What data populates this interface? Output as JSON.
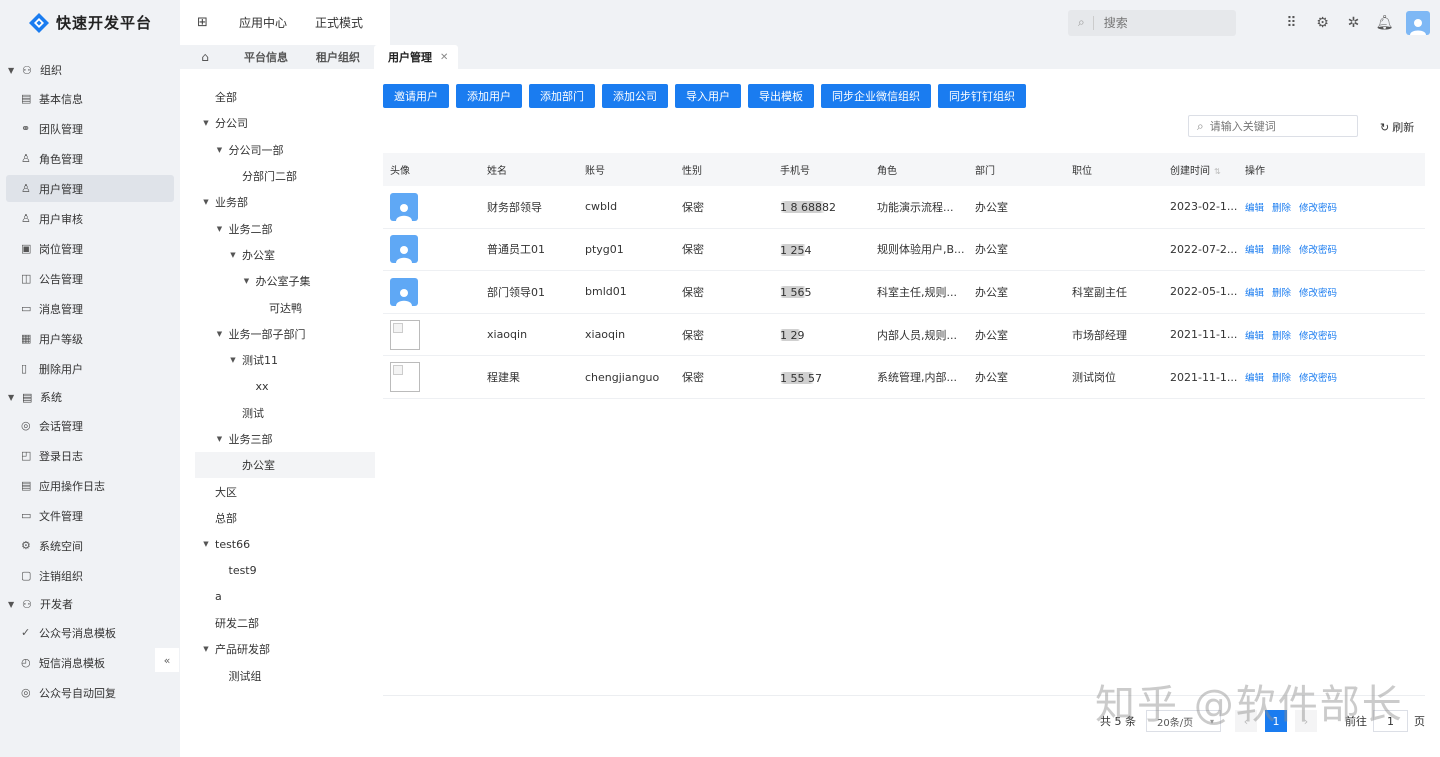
{
  "app": {
    "title": "快速开发平台"
  },
  "topnav": {
    "items": [
      "应用中心",
      "正式模式"
    ]
  },
  "header": {
    "search_placeholder": "搜索"
  },
  "colors": {
    "primary": "#1a7cf0",
    "sidebar_bg": "#f0f2f5",
    "avatar": "#5fa8f5"
  },
  "sidebar": {
    "groups": [
      {
        "label": "组织",
        "icon": "org-icon",
        "items": [
          {
            "label": "基本信息",
            "icon": "info-icon"
          },
          {
            "label": "团队管理",
            "icon": "team-icon"
          },
          {
            "label": "角色管理",
            "icon": "role-icon"
          },
          {
            "label": "用户管理",
            "icon": "user-icon",
            "active": true
          },
          {
            "label": "用户审核",
            "icon": "audit-icon"
          },
          {
            "label": "岗位管理",
            "icon": "post-icon"
          },
          {
            "label": "公告管理",
            "icon": "notice-icon"
          },
          {
            "label": "消息管理",
            "icon": "message-icon"
          },
          {
            "label": "用户等级",
            "icon": "level-icon"
          },
          {
            "label": "删除用户",
            "icon": "trash-icon"
          }
        ]
      },
      {
        "label": "系统",
        "icon": "system-icon",
        "items": [
          {
            "label": "会话管理",
            "icon": "session-icon"
          },
          {
            "label": "登录日志",
            "icon": "login-log-icon"
          },
          {
            "label": "应用操作日志",
            "icon": "op-log-icon"
          },
          {
            "label": "文件管理",
            "icon": "folder-icon"
          },
          {
            "label": "系统空间",
            "icon": "space-icon"
          },
          {
            "label": "注销组织",
            "icon": "cancel-org-icon"
          }
        ]
      },
      {
        "label": "开发者",
        "icon": "developer-icon",
        "items": [
          {
            "label": "公众号消息模板",
            "icon": "template-icon"
          },
          {
            "label": "短信消息模板",
            "icon": "sms-icon"
          },
          {
            "label": "公众号自动回复",
            "icon": "reply-icon"
          }
        ]
      }
    ]
  },
  "tabs": {
    "items": [
      "平台信息",
      "租户组织",
      "用户管理"
    ],
    "active": "用户管理"
  },
  "tree": [
    {
      "label": "全部",
      "level": 0,
      "caret": false
    },
    {
      "label": "分公司",
      "level": 0,
      "caret": true
    },
    {
      "label": "分公司一部",
      "level": 1,
      "caret": true
    },
    {
      "label": "分部门二部",
      "level": 2,
      "caret": false
    },
    {
      "label": "业务部",
      "level": 0,
      "caret": true
    },
    {
      "label": "业务二部",
      "level": 1,
      "caret": true
    },
    {
      "label": "办公室",
      "level": 2,
      "caret": true
    },
    {
      "label": "办公室子集",
      "level": 3,
      "caret": true
    },
    {
      "label": "可达鸭",
      "level": 4,
      "caret": false
    },
    {
      "label": "业务一部子部门",
      "level": 1,
      "caret": true
    },
    {
      "label": "测试11",
      "level": 2,
      "caret": true
    },
    {
      "label": "xx",
      "level": 3,
      "caret": false
    },
    {
      "label": "测试",
      "level": 2,
      "caret": false
    },
    {
      "label": "业务三部",
      "level": 1,
      "caret": true
    },
    {
      "label": "办公室",
      "level": 2,
      "caret": false,
      "selected": true
    },
    {
      "label": "大区",
      "level": 0,
      "caret": false
    },
    {
      "label": "总部",
      "level": 0,
      "caret": false
    },
    {
      "label": "test66",
      "level": 0,
      "caret": true
    },
    {
      "label": "test9",
      "level": 1,
      "caret": false
    },
    {
      "label": "a",
      "level": 0,
      "caret": false
    },
    {
      "label": "研发二部",
      "level": 0,
      "caret": false
    },
    {
      "label": "产品研发部",
      "level": 0,
      "caret": true
    },
    {
      "label": "测试组",
      "level": 1,
      "caret": false
    }
  ],
  "toolbar": {
    "buttons": [
      "邀请用户",
      "添加用户",
      "添加部门",
      "添加公司",
      "导入用户",
      "导出模板",
      "同步企业微信组织",
      "同步钉钉组织"
    ]
  },
  "filter": {
    "keyword_placeholder": "请输入关键词",
    "refresh_label": "刷新"
  },
  "table": {
    "headers": [
      "头像",
      "姓名",
      "账号",
      "性别",
      "手机号",
      "角色",
      "部门",
      "职位",
      "创建时间",
      "操作"
    ],
    "rows": [
      {
        "avatar": "default",
        "name": "财务部领导",
        "account": "cwbld",
        "gender": "保密",
        "phone": "1  8    68882",
        "role": "功能演示流程...",
        "dept": "办公室",
        "position": "",
        "created": "2023-02-1..."
      },
      {
        "avatar": "default",
        "name": "普通员工01",
        "account": "ptyg01",
        "gender": "保密",
        "phone": "1        254",
        "role": "规则体验用户,B...",
        "dept": "办公室",
        "position": "",
        "created": "2022-07-2..."
      },
      {
        "avatar": "default",
        "name": "部门领导01",
        "account": "bmld01",
        "gender": "保密",
        "phone": "1        565",
        "role": "科室主任,规则...",
        "dept": "办公室",
        "position": "科室副主任",
        "created": "2022-05-1..."
      },
      {
        "avatar": "broken",
        "name": "xiaoqin",
        "account": "xiaoqin",
        "gender": "保密",
        "phone": "1         29",
        "role": "内部人员,规则...",
        "dept": "办公室",
        "position": "市场部经理",
        "created": "2021-11-1..."
      },
      {
        "avatar": "broken",
        "name": "程建果",
        "account": "chengjianguo",
        "gender": "保密",
        "phone": "1  55   57",
        "role": "系统管理,内部...",
        "dept": "办公室",
        "position": "测试岗位",
        "created": "2021-11-1..."
      }
    ],
    "ops": [
      "编辑",
      "删除",
      "修改密码"
    ]
  },
  "pagination": {
    "total_text": "共 5 条",
    "page_size": "20条/页",
    "current_page": "1",
    "goto_label": "前往",
    "goto_value": "1",
    "page_unit": "页"
  },
  "watermark": "知乎 @软件部长"
}
